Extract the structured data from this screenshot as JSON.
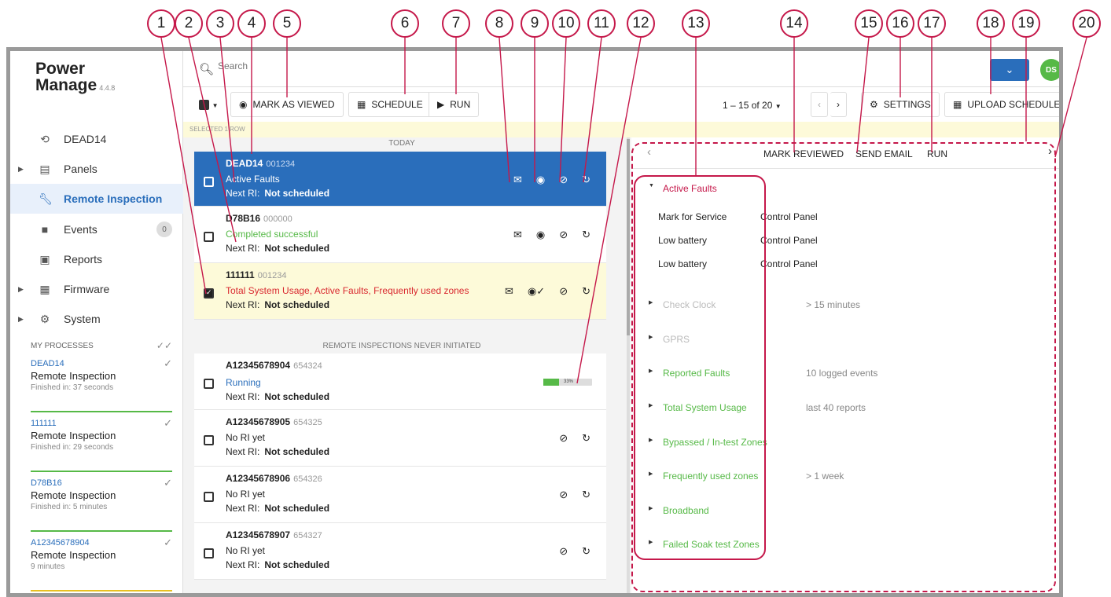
{
  "callouts": [
    "1",
    "2",
    "3",
    "4",
    "5",
    "6",
    "7",
    "8",
    "9",
    "10",
    "11",
    "12",
    "13",
    "14",
    "15",
    "16",
    "17",
    "18",
    "19",
    "20"
  ],
  "app": {
    "name_line1": "Power",
    "name_line2": "Manage",
    "version": "4.4.8"
  },
  "sidebar": {
    "items": [
      {
        "label": "DEAD14",
        "icon": "history-icon"
      },
      {
        "label": "Panels",
        "icon": "panel-icon"
      },
      {
        "label": "Remote Inspection",
        "icon": "wrench-icon"
      },
      {
        "label": "Events",
        "icon": "alert-icon",
        "badge": "0"
      },
      {
        "label": "Reports",
        "icon": "clipboard-icon"
      },
      {
        "label": "Firmware",
        "icon": "chip-icon"
      },
      {
        "label": "System",
        "icon": "gear-icon"
      }
    ],
    "processes_title": "MY PROCESSES",
    "processes": [
      {
        "id": "DEAD14",
        "title": "Remote Inspection",
        "sub": "Finished in: 37 seconds"
      },
      {
        "id": "111111",
        "title": "Remote Inspection",
        "sub": "Finished in: 29 seconds"
      },
      {
        "id": "D78B16",
        "title": "Remote Inspection",
        "sub": "Finished in: 5 minutes"
      },
      {
        "id": "A12345678904",
        "title": "Remote Inspection",
        "sub": "9 minutes"
      }
    ]
  },
  "search": {
    "placeholder": "Search"
  },
  "user": {
    "initials": "DS"
  },
  "toolbar": {
    "mark_viewed": "MARK AS VIEWED",
    "schedule": "SCHEDULE",
    "run": "RUN",
    "pager": "1 – 15 of 20",
    "settings": "SETTINGS",
    "upload_schedule": "UPLOAD SCHEDULE"
  },
  "selected_text": "SELECTED 1 ROW",
  "list": {
    "today_label": "TODAY",
    "never_label": "REMOTE INSPECTIONS NEVER INITIATED",
    "next_label": "Next RI:",
    "next_value": "Not scheduled",
    "rows": [
      {
        "id": "DEAD14",
        "num": "001234",
        "status": "Active Faults"
      },
      {
        "id": "D78B16",
        "num": "000000",
        "status": "Completed successful"
      },
      {
        "id": "111111",
        "num": "001234",
        "status": "Total System Usage, Active Faults, Frequently used zones"
      },
      {
        "id": "A12345678904",
        "num": "654324",
        "status": "Running",
        "progress": 33,
        "progress_text": "33%"
      },
      {
        "id": "A12345678905",
        "num": "654325",
        "status": "No RI yet"
      },
      {
        "id": "A12345678906",
        "num": "654326",
        "status": "No RI yet"
      },
      {
        "id": "A12345678907",
        "num": "654327",
        "status": "No RI yet"
      }
    ]
  },
  "detail": {
    "mark_reviewed": "MARK REVIEWED",
    "send_email": "SEND EMAIL",
    "run": "RUN",
    "sections": [
      {
        "title": "Active Faults",
        "info": ""
      },
      {
        "title": "Check Clock",
        "info": "> 15 minutes"
      },
      {
        "title": "GPRS",
        "info": ""
      },
      {
        "title": "Reported Faults",
        "info": "10 logged events"
      },
      {
        "title": "Total System Usage",
        "info": "last 40 reports"
      },
      {
        "title": "Bypassed / In-test Zones",
        "info": ""
      },
      {
        "title": "Frequently used zones",
        "info": "> 1 week"
      },
      {
        "title": "Broadband",
        "info": ""
      },
      {
        "title": "Failed Soak test Zones",
        "info": ""
      }
    ],
    "faults": [
      {
        "name": "Mark for Service",
        "loc": "Control Panel"
      },
      {
        "name": "Low battery",
        "loc": "Control Panel"
      },
      {
        "name": "Low battery",
        "loc": "Control Panel"
      }
    ]
  },
  "colors": {
    "accent": "#2a6ebb",
    "success": "#56b947",
    "error": "#d9282f",
    "annotation": "#c5184a",
    "highlight": "#fdfad9"
  }
}
